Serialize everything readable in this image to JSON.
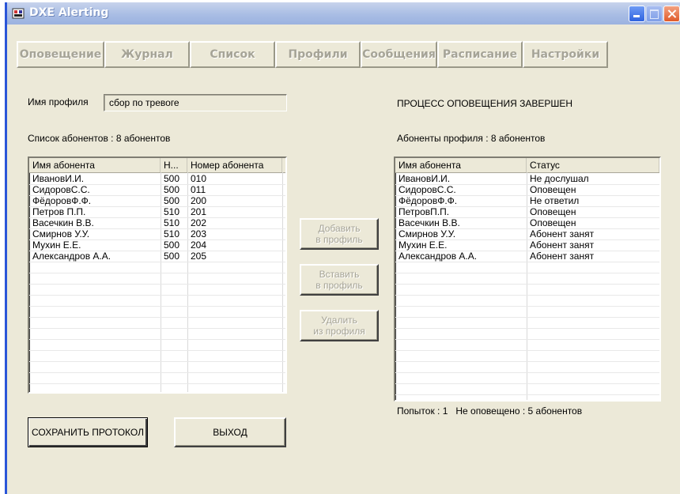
{
  "window": {
    "title": "DXE Alerting"
  },
  "tabs": [
    "Оповещение",
    "Журнал",
    "Список",
    "Профили",
    "Сообщения",
    "Расписание",
    "Настройки"
  ],
  "profile": {
    "label": "Имя профиля",
    "value": "сбор по тревоге"
  },
  "status_message": "ПРОЦЕСС ОПОВЕЩЕНИЯ ЗАВЕРШЕН",
  "left_list": {
    "caption": "Список абонентов : 8 абонентов",
    "columns": [
      "Имя абонента",
      "Н...",
      "Номер абонента"
    ],
    "rows": [
      [
        "ИвановИ.И.",
        "500",
        "010"
      ],
      [
        "СидоровС.С.",
        "500",
        "011"
      ],
      [
        "ФёдоровФ.Ф.",
        "500",
        "200"
      ],
      [
        "Петров П.П.",
        "510",
        "201"
      ],
      [
        "Васечкин В.В.",
        "510",
        "202"
      ],
      [
        "Смирнов У.У.",
        "510",
        "203"
      ],
      [
        "Мухин Е.Е.",
        "500",
        "204"
      ],
      [
        "Александров А.А.",
        "500",
        "205"
      ]
    ]
  },
  "right_list": {
    "caption": "Абоненты профиля : 8 абонентов",
    "columns": [
      "Имя абонента",
      "Статус"
    ],
    "rows": [
      [
        "ИвановИ.И.",
        "Не дослушал"
      ],
      [
        "СидоровС.С.",
        "Оповещен"
      ],
      [
        "ФёдоровФ.Ф.",
        "Не ответил"
      ],
      [
        "ПетровП.П.",
        "Оповещен"
      ],
      [
        "Васечкин В.В.",
        "Оповещен"
      ],
      [
        "Смирнов У.У.",
        "Абонент занят"
      ],
      [
        "Мухин Е.Е.",
        "Абонент занят"
      ],
      [
        "Александров А.А.",
        "Абонент занят"
      ]
    ]
  },
  "middle_buttons": {
    "add": [
      "Добавить",
      "в профиль"
    ],
    "insert": [
      "Вставить",
      "в профиль"
    ],
    "remove": [
      "Удалить",
      "из профиля"
    ]
  },
  "footer_status": "Попыток : 1   Не оповещено : 5 абонентов",
  "buttons": {
    "save": "СОХРАНИТЬ ПРОТОКОЛ",
    "exit": "ВЫХОД"
  }
}
